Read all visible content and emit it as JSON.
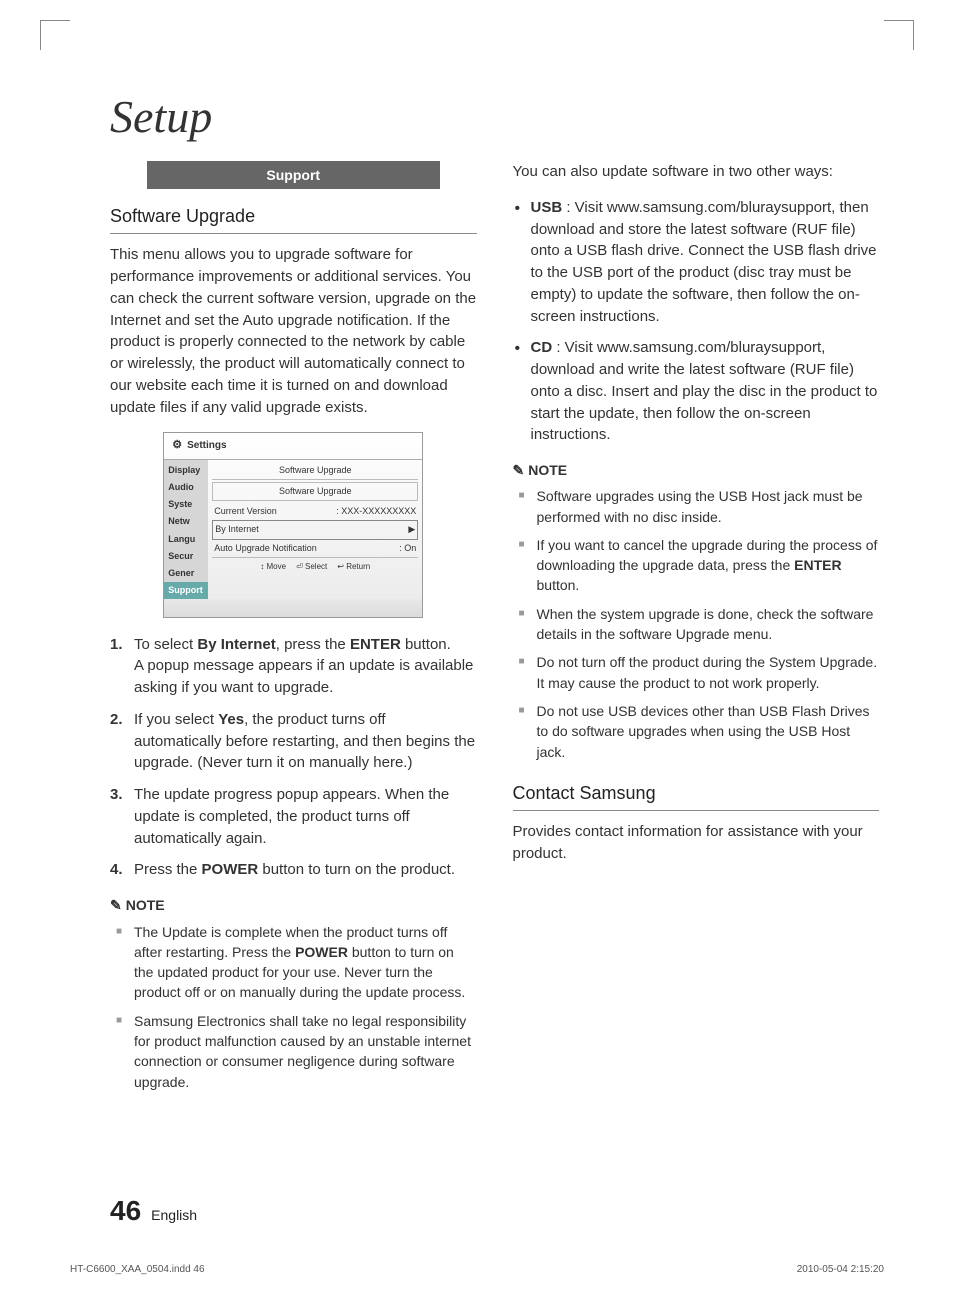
{
  "section_title": "Setup",
  "left": {
    "support_bar": "Support",
    "h_software_upgrade": "Software Upgrade",
    "intro": "This menu allows you to upgrade software for performance improvements or additional services. You can check the current software version, upgrade on the Internet and set the Auto upgrade notification. If the product is properly connected to the network by cable or wirelessly, the product will automatically connect to our website each time it is turned on and download update files if any valid upgrade exists.",
    "settings": {
      "title": "Settings",
      "side": [
        "Display",
        "Audio",
        "Syste",
        "Netw",
        "Langu",
        "Secur",
        "Gener",
        "Support"
      ],
      "side_active_index": 7,
      "main_hdr": "Software Upgrade",
      "sub_hdr": "Software Upgrade",
      "row1_l": "Current Version",
      "row1_r": ": XXX-XXXXXXXXX",
      "row2_l": "By Internet",
      "row2_r": "▶",
      "row3_l": "Auto Upgrade Notification",
      "row3_r": ": On",
      "footer": {
        "move": "↕ Move",
        "select": "⏎ Select",
        "return": "↩ Return"
      }
    },
    "steps": [
      {
        "num": "1.",
        "text_a": "To select ",
        "b1": "By Internet",
        "text_b": ", press the ",
        "b2": "ENTER",
        "text_c": " button.",
        "tail": "A popup message appears if an update is available asking if you want to upgrade."
      },
      {
        "num": "2.",
        "text_a": "If you select ",
        "b1": "Yes",
        "text_b": ", the product turns off automatically before restarting, and then begins the upgrade. (Never turn it on manually here.)"
      },
      {
        "num": "3.",
        "text_a": "The update progress popup appears. When the update is completed, the product turns off automatically again."
      },
      {
        "num": "4.",
        "text_a": "Press the ",
        "b1": "POWER",
        "text_b": " button to turn on the product."
      }
    ],
    "note_label": "NOTE",
    "notes": [
      {
        "pre": "The Update is complete when the product turns off after restarting. Press the ",
        "b": "POWER",
        "post": " button to turn on the updated product for your use. Never turn the product off or on manually during the update process."
      },
      {
        "pre": "Samsung Electronics shall take no legal responsibility for product malfunction caused by an unstable internet connection or consumer negligence during software upgrade."
      }
    ]
  },
  "right": {
    "intro": "You can also update software in two other ways:",
    "bullets": [
      {
        "b": "USB",
        "text": " : Visit www.samsung.com/bluraysupport, then download and store the latest software (RUF file) onto a USB flash drive. Connect the USB flash drive to the USB port of the product (disc tray must be empty) to update the software, then follow the on-screen instructions."
      },
      {
        "b": "CD",
        "text": " : Visit www.samsung.com/bluraysupport, download and write the latest software (RUF file) onto a disc. Insert and play the disc in the product to start the update, then follow the on-screen instructions."
      }
    ],
    "note_label": "NOTE",
    "notes": [
      "Software upgrades using the USB Host jack must be performed with no disc inside.",
      {
        "pre": "If you want to cancel the upgrade during the process of downloading the upgrade data, press the ",
        "b": "ENTER",
        "post": " button."
      },
      "When the system upgrade is done, check the software details in the software Upgrade menu.",
      "Do not turn off the product during the System Upgrade. It may cause the product to not work properly.",
      "Do not use USB devices other than USB Flash Drives to do software upgrades when using the USB Host jack."
    ],
    "h_contact": "Contact Samsung",
    "contact_text": "Provides contact information for assistance with your product."
  },
  "footer": {
    "page_num": "46",
    "lang": "English",
    "indd": "HT-C6600_XAA_0504.indd   46",
    "timestamp": "2010-05-04   2:15:20"
  }
}
